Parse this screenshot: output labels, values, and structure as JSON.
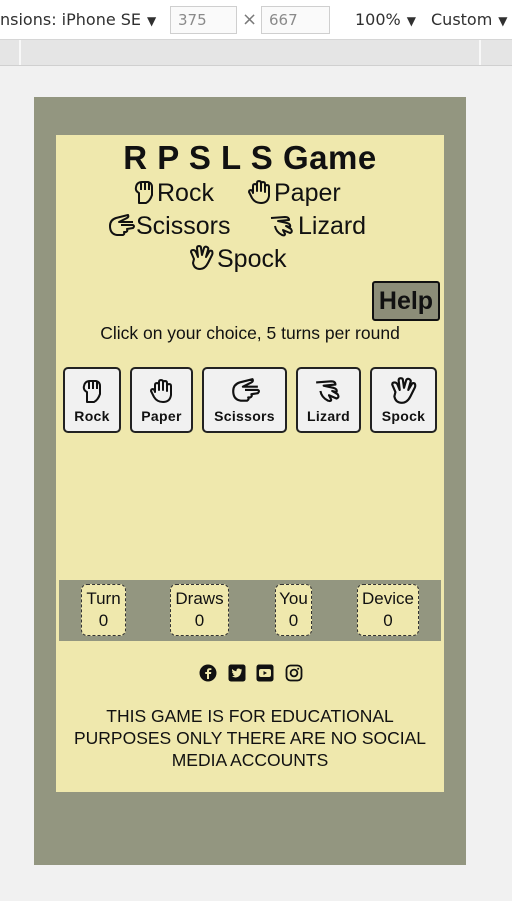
{
  "devtools": {
    "dimensions_label": "nsions: iPhone SE",
    "width": "375",
    "height": "667",
    "times": "×",
    "zoom": "100%",
    "throttle": "Custom"
  },
  "game": {
    "title": "R P S L S Game",
    "header_choices": [
      "Rock",
      "Paper",
      "Scissors",
      "Lizard",
      "Spock"
    ],
    "help_label": "Help",
    "instructions": "Click on your choice, 5 turns per round",
    "buttons": [
      "Rock",
      "Paper",
      "Scissors",
      "Lizard",
      "Spock"
    ],
    "scores": [
      {
        "label": "Turn",
        "value": "0"
      },
      {
        "label": "Draws",
        "value": "0"
      },
      {
        "label": "You",
        "value": "0"
      },
      {
        "label": "Device",
        "value": "0"
      }
    ],
    "socials": [
      "facebook-icon",
      "twitter-icon",
      "youtube-icon",
      "instagram-icon"
    ],
    "disclaimer": "THIS GAME IS FOR EDUCATIONAL PURPOSES ONLY THERE ARE NO SOCIAL MEDIA ACCOUNTS"
  }
}
